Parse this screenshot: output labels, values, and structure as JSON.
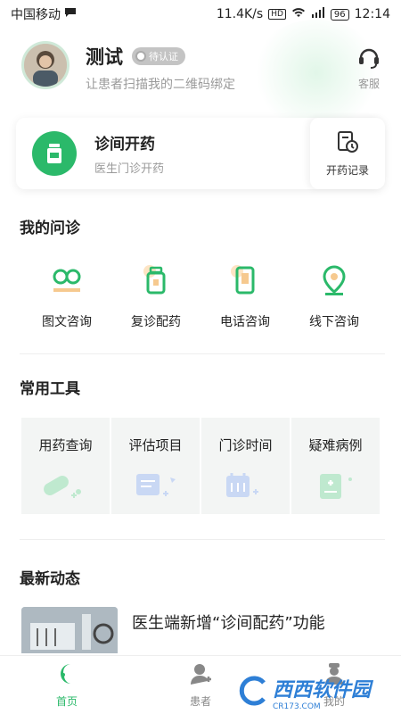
{
  "statusbar": {
    "carrier": "中国移动",
    "speed": "11.4K/s",
    "hd": "HD",
    "net": "4G",
    "battery": "96",
    "time": "12:14"
  },
  "profile": {
    "name": "测试",
    "verify_label": "待认证",
    "subtitle": "让患者扫描我的二维码绑定",
    "service_label": "客服"
  },
  "prescribe_card": {
    "title": "诊间开药",
    "subtitle": "医生门诊开药",
    "record_label": "开药记录"
  },
  "my_consult": {
    "title": "我的问诊",
    "items": [
      {
        "label": "图文咨询",
        "icon": "chat-icon"
      },
      {
        "label": "复诊配药",
        "icon": "medicine-bottle-icon"
      },
      {
        "label": "电话咨询",
        "icon": "phone-icon"
      },
      {
        "label": "线下咨询",
        "icon": "location-pin-icon"
      }
    ]
  },
  "tools": {
    "title": "常用工具",
    "items": [
      {
        "label": "用药查询",
        "icon": "pill-icon"
      },
      {
        "label": "评估项目",
        "icon": "assessment-icon"
      },
      {
        "label": "门诊时间",
        "icon": "calendar-icon"
      },
      {
        "label": "疑难病例",
        "icon": "medical-record-icon"
      }
    ]
  },
  "news": {
    "title": "最新动态",
    "items": [
      {
        "title": "医生端新增“诊间配药”功能"
      }
    ]
  },
  "tabbar": {
    "items": [
      {
        "label": "首页",
        "active": true
      },
      {
        "label": "患者",
        "active": false
      },
      {
        "label": "我的",
        "active": false
      }
    ]
  },
  "watermark": {
    "text": "西西软件园",
    "sub": "CR173.COM"
  },
  "colors": {
    "accent": "#2bb96a",
    "muted": "#9a9a9a"
  }
}
